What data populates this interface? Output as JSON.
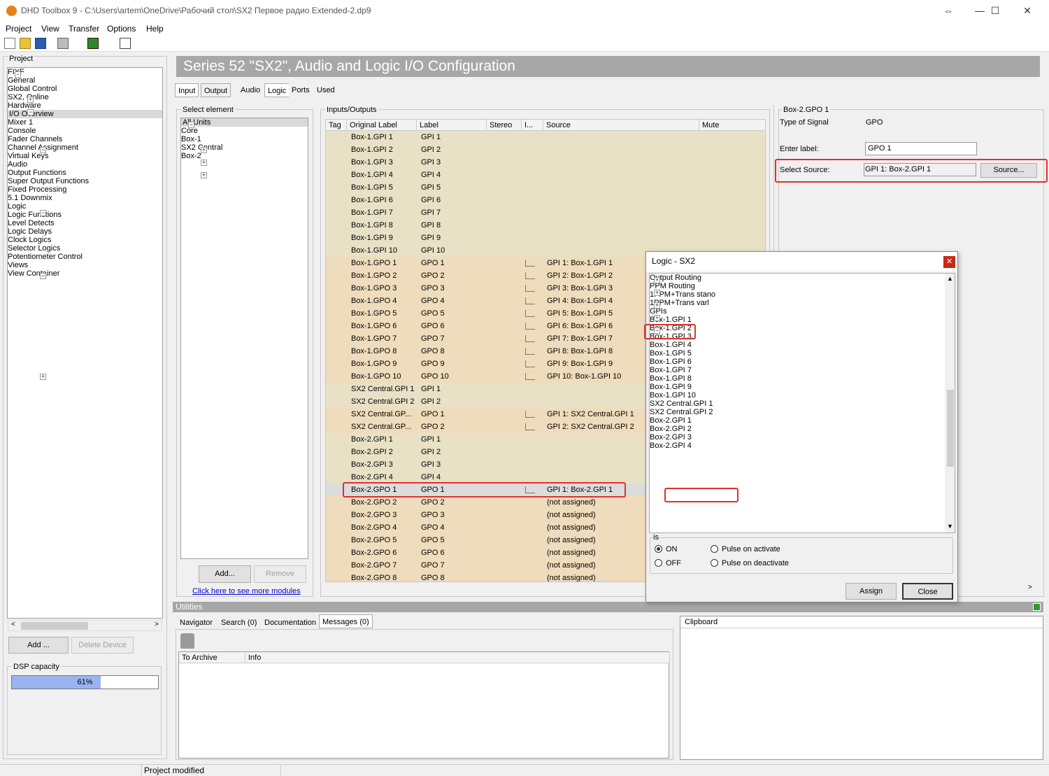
{
  "window": {
    "title": "DHD Toolbox 9 - C:\\Users\\artem\\OneDrive\\Рабочий стол\\SX2 Первое радио Extended-2.dp9"
  },
  "menu": [
    "Project",
    "View",
    "Transfer",
    "Options",
    "Help"
  ],
  "project_panel": {
    "title": "Project",
    "tree": [
      {
        "label": "FIYF",
        "level": 0,
        "exp": "−"
      },
      {
        "label": "General",
        "level": 1
      },
      {
        "label": "Global Control",
        "level": 1,
        "exp": "+"
      },
      {
        "label": "SX2, Online",
        "level": 1,
        "exp": "−"
      },
      {
        "label": "Hardware",
        "level": 2
      },
      {
        "label": "I/O Overview",
        "level": 2,
        "selected": true
      },
      {
        "label": "Mixer 1",
        "level": 2,
        "exp": "−"
      },
      {
        "label": "Console",
        "level": 3
      },
      {
        "label": "Fader Channels",
        "level": 3
      },
      {
        "label": "Channel Assignment",
        "level": 3
      },
      {
        "label": "Virtual Keys",
        "level": 3
      },
      {
        "label": "Audio",
        "level": 2,
        "exp": "−"
      },
      {
        "label": "Output Functions",
        "level": 3
      },
      {
        "label": "Super Output Functions",
        "level": 3
      },
      {
        "label": "Fixed Processing",
        "level": 3
      },
      {
        "label": "5.1 Downmix",
        "level": 3
      },
      {
        "label": "Logic",
        "level": 2,
        "exp": "−"
      },
      {
        "label": "Logic Functions",
        "level": 3
      },
      {
        "label": "Level Detects",
        "level": 3
      },
      {
        "label": "Logic Delays",
        "level": 3
      },
      {
        "label": "Clock Logics",
        "level": 3
      },
      {
        "label": "Selector Logics",
        "level": 3
      },
      {
        "label": "Potentiometer Control",
        "level": 3
      },
      {
        "label": "Views",
        "level": 2
      },
      {
        "label": "View Container",
        "level": 2,
        "exp": "+"
      }
    ],
    "add_button": "Add ...",
    "delete_button": "Delete Device",
    "dsp_title": "DSP capacity",
    "dsp_percent": 61,
    "dsp_label": "61%"
  },
  "header": {
    "title": "Series 52 \"SX2\", Audio and Logic I/O  Configuration"
  },
  "tabs_left": [
    "Input",
    "Output"
  ],
  "tabs_right": [
    "Audio",
    "Logic",
    "Ports",
    "Used"
  ],
  "select_element": {
    "title": "Select element",
    "tree": [
      {
        "label": "All Units",
        "level": 0,
        "exp": "−",
        "selected": true
      },
      {
        "label": "Core",
        "level": 1
      },
      {
        "label": "Box-1",
        "level": 1,
        "exp": "+"
      },
      {
        "label": "SX2 Central",
        "level": 1,
        "exp": "+"
      },
      {
        "label": "Box-2",
        "level": 1,
        "exp": "+"
      }
    ],
    "add_button": "Add...",
    "remove_button": "Remove",
    "more_link": "Click here to see more modules"
  },
  "io": {
    "title": "Inputs/Outputs",
    "columns": [
      "Tag",
      "Original Label",
      "Label",
      "Stereo",
      "I...",
      "Source",
      "Mute"
    ],
    "rows": [
      {
        "orig": "Box-1.GPI 1",
        "label": "GPI 1",
        "src": "",
        "kind": "gpi"
      },
      {
        "orig": "Box-1.GPI 2",
        "label": "GPI 2",
        "src": "",
        "kind": "gpi"
      },
      {
        "orig": "Box-1.GPI 3",
        "label": "GPI 3",
        "src": "",
        "kind": "gpi"
      },
      {
        "orig": "Box-1.GPI 4",
        "label": "GPI 4",
        "src": "",
        "kind": "gpi"
      },
      {
        "orig": "Box-1.GPI 5",
        "label": "GPI 5",
        "src": "",
        "kind": "gpi"
      },
      {
        "orig": "Box-1.GPI 6",
        "label": "GPI 6",
        "src": "",
        "kind": "gpi"
      },
      {
        "orig": "Box-1.GPI 7",
        "label": "GPI 7",
        "src": "",
        "kind": "gpi"
      },
      {
        "orig": "Box-1.GPI 8",
        "label": "GPI 8",
        "src": "",
        "kind": "gpi"
      },
      {
        "orig": "Box-1.GPI 9",
        "label": "GPI 9",
        "src": "",
        "kind": "gpi"
      },
      {
        "orig": "Box-1.GPI 10",
        "label": "GPI 10",
        "src": "",
        "kind": "gpi"
      },
      {
        "orig": "Box-1.GPO 1",
        "label": "GPO 1",
        "src": "GPI 1: Box-1.GPI 1",
        "kind": "gpo",
        "link": true
      },
      {
        "orig": "Box-1.GPO 2",
        "label": "GPO 2",
        "src": "GPI 2: Box-1.GPI 2",
        "kind": "gpo",
        "link": true
      },
      {
        "orig": "Box-1.GPO 3",
        "label": "GPO 3",
        "src": "GPI 3: Box-1.GPI 3",
        "kind": "gpo",
        "link": true
      },
      {
        "orig": "Box-1.GPO 4",
        "label": "GPO 4",
        "src": "GPI 4: Box-1.GPI 4",
        "kind": "gpo",
        "link": true
      },
      {
        "orig": "Box-1.GPO 5",
        "label": "GPO 5",
        "src": "GPI 5: Box-1.GPI 5",
        "kind": "gpo",
        "link": true
      },
      {
        "orig": "Box-1.GPO 6",
        "label": "GPO 6",
        "src": "GPI 6: Box-1.GPI 6",
        "kind": "gpo",
        "link": true
      },
      {
        "orig": "Box-1.GPO 7",
        "label": "GPO 7",
        "src": "GPI 7: Box-1.GPI 7",
        "kind": "gpo",
        "link": true
      },
      {
        "orig": "Box-1.GPO 8",
        "label": "GPO 8",
        "src": "GPI 8: Box-1.GPI 8",
        "kind": "gpo",
        "link": true
      },
      {
        "orig": "Box-1.GPO 9",
        "label": "GPO 9",
        "src": "GPI 9: Box-1.GPI 9",
        "kind": "gpo",
        "link": true
      },
      {
        "orig": "Box-1.GPO 10",
        "label": "GPO 10",
        "src": "GPI 10: Box-1.GPI 10",
        "kind": "gpo",
        "link": true
      },
      {
        "orig": "SX2 Central.GPI 1",
        "label": "GPI 1",
        "src": "",
        "kind": "gpi"
      },
      {
        "orig": "SX2 Central.GPI 2",
        "label": "GPI 2",
        "src": "",
        "kind": "gpi"
      },
      {
        "orig": "SX2 Central.GP...",
        "label": "GPO 1",
        "src": "GPI 1: SX2 Central.GPI 1",
        "kind": "gpo",
        "link": true
      },
      {
        "orig": "SX2 Central.GP...",
        "label": "GPO 2",
        "src": "GPI 2: SX2 Central.GPI 2",
        "kind": "gpo",
        "link": true
      },
      {
        "orig": "Box-2.GPI 1",
        "label": "GPI 1",
        "src": "",
        "kind": "gpi"
      },
      {
        "orig": "Box-2.GPI 2",
        "label": "GPI 2",
        "src": "",
        "kind": "gpi"
      },
      {
        "orig": "Box-2.GPI 3",
        "label": "GPI 3",
        "src": "",
        "kind": "gpi"
      },
      {
        "orig": "Box-2.GPI 4",
        "label": "GPI 4",
        "src": "",
        "kind": "gpi"
      },
      {
        "orig": "Box-2.GPO 1",
        "label": "GPO 1",
        "src": "GPI 1: Box-2.GPI 1",
        "kind": "sel",
        "link": true
      },
      {
        "orig": "Box-2.GPO 2",
        "label": "GPO 2",
        "src": "(not assigned)",
        "kind": "gpo"
      },
      {
        "orig": "Box-2.GPO 3",
        "label": "GPO 3",
        "src": "(not assigned)",
        "kind": "gpo"
      },
      {
        "orig": "Box-2.GPO 4",
        "label": "GPO 4",
        "src": "(not assigned)",
        "kind": "gpo"
      },
      {
        "orig": "Box-2.GPO 5",
        "label": "GPO 5",
        "src": "(not assigned)",
        "kind": "gpo"
      },
      {
        "orig": "Box-2.GPO 6",
        "label": "GPO 6",
        "src": "(not assigned)",
        "kind": "gpo"
      },
      {
        "orig": "Box-2.GPO 7",
        "label": "GPO 7",
        "src": "(not assigned)",
        "kind": "gpo"
      },
      {
        "orig": "Box-2.GPO 8",
        "label": "GPO 8",
        "src": "(not assigned)",
        "kind": "gpo"
      }
    ]
  },
  "props": {
    "title": "Box-2.GPO 1",
    "type_label": "Type of Signal",
    "type_value": "GPO",
    "enter_label": "Enter label:",
    "label_value": "GPO 1",
    "select_source": "Select Source:",
    "source_value": "GPI 1: Box-2.GPI 1",
    "source_button": "Source..."
  },
  "dialog": {
    "title": "Logic - SX2",
    "tree": [
      {
        "label": "Output Routing",
        "level": 0,
        "exp": "+"
      },
      {
        "label": "PPM Routing",
        "level": 0,
        "exp": "+"
      },
      {
        "label": "1PPM+Trans stano",
        "level": 0,
        "exp": "+"
      },
      {
        "label": "1PPM+Trans varl",
        "level": 0,
        "exp": "+"
      },
      {
        "label": "GPIs",
        "level": 0,
        "exp": "−"
      },
      {
        "label": "Box-1.GPI 1",
        "level": 1
      },
      {
        "label": "Box-1.GPI 2",
        "level": 1
      },
      {
        "label": "Box-1.GPI 3",
        "level": 1
      },
      {
        "label": "Box-1.GPI 4",
        "level": 1
      },
      {
        "label": "Box-1.GPI 5",
        "level": 1
      },
      {
        "label": "Box-1.GPI 6",
        "level": 1
      },
      {
        "label": "Box-1.GPI 7",
        "level": 1
      },
      {
        "label": "Box-1.GPI 8",
        "level": 1
      },
      {
        "label": "Box-1.GPI 9",
        "level": 1
      },
      {
        "label": "Box-1.GPI 10",
        "level": 1
      },
      {
        "label": "SX2 Central.GPI 1",
        "level": 1
      },
      {
        "label": "SX2 Central.GPI 2",
        "level": 1
      },
      {
        "label": "Box-2.GPI 1",
        "level": 1
      },
      {
        "label": "Box-2.GPI 2",
        "level": 1
      },
      {
        "label": "Box-2.GPI 3",
        "level": 1
      },
      {
        "label": "Box-2.GPI 4",
        "level": 1
      }
    ],
    "is_label": "is",
    "on": "ON",
    "off": "OFF",
    "pulse_activate": "Pulse on activate",
    "pulse_deactivate": "Pulse on deactivate",
    "assign_button": "Assign",
    "close_button": "Close"
  },
  "utilities": {
    "title": "Utilities",
    "tabs": [
      "Navigator",
      "Search (0)",
      "Documentation",
      "Messages (0)"
    ],
    "columns": [
      "To Archive",
      "Info"
    ],
    "clipboard": "Clipboard"
  },
  "status": {
    "text": "Project modified"
  },
  "colors": {
    "gpi": "#e8e1c6",
    "gpo": "#efdcbc",
    "sel": "#dcdcdc",
    "highlight": "#e0302a",
    "dsp": "#99b4f0"
  }
}
